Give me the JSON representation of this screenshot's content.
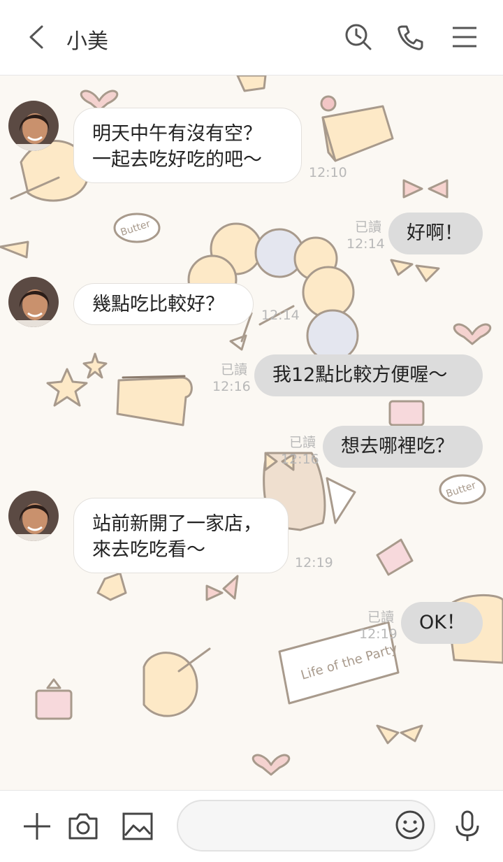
{
  "header": {
    "title": "小美",
    "icons": [
      "back-arrow-icon",
      "search-history-icon",
      "phone-icon",
      "menu-icon"
    ]
  },
  "messages": [
    {
      "side": "in",
      "text": "明天中午有沒有空？\n一起去吃好吃的吧～",
      "time": "12:10"
    },
    {
      "side": "out",
      "text": "好啊！",
      "read": "已讀",
      "time": "12:14"
    },
    {
      "side": "in",
      "text": "幾點吃比較好？",
      "time": "12:14"
    },
    {
      "side": "out",
      "text": "我12點比較方便喔～",
      "read": "已讀",
      "time": "12:16"
    },
    {
      "side": "out",
      "text": "想去哪裡吃？",
      "read": "已讀",
      "time": "12:16"
    },
    {
      "side": "in",
      "text": "站前新開了一家店，\n來去吃吃看～",
      "time": "12:19"
    },
    {
      "side": "out",
      "text": "OK！",
      "read": "已讀",
      "time": "12:19"
    }
  ],
  "background_stickers": [
    "Butter",
    "Butter",
    "Life of the Party"
  ],
  "footer": {
    "input_placeholder": "",
    "icons": [
      "plus-icon",
      "camera-icon",
      "image-icon",
      "emoji-icon",
      "microphone-icon"
    ]
  },
  "colors": {
    "incoming_bubble": "#ffffff",
    "outgoing_bubble": "#dcdcdc",
    "chat_background": "#fbf8f3",
    "meta_text": "#b8b8b8"
  }
}
